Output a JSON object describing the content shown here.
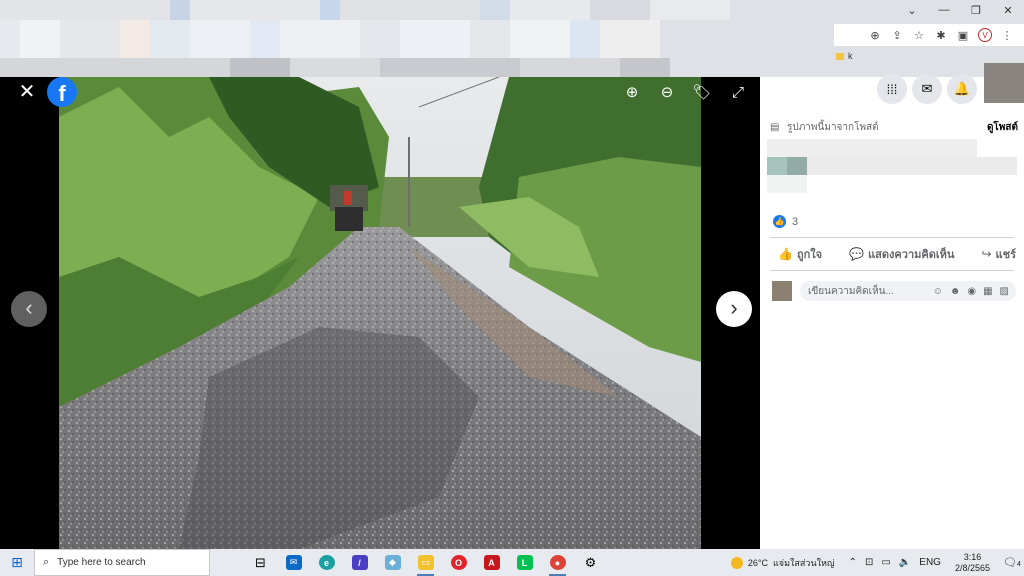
{
  "browser": {
    "window_controls": [
      "⌄",
      "—",
      "❐",
      "✕"
    ],
    "bookmark_tail": "k",
    "chrome_colors": [
      "#e9e9ec",
      "#dcdde3",
      "#cfd3db",
      "#c6d6ea",
      "#e2e4e8",
      "#d5d8de",
      "#ebeced",
      "#c9d3e2"
    ]
  },
  "viewer": {
    "close_label": "✕",
    "logo_letter": "f",
    "tools": {
      "zoom_in": "⊕",
      "zoom_out": "⊖",
      "tag": "🏷",
      "fullscreen": "⤢"
    },
    "prev_label": "‹",
    "next_label": "›"
  },
  "panel": {
    "from_post_text": "รูปภาพนี้มาจากโพสต์",
    "view_post_link": "ดูโพสต์",
    "reaction_count": "3",
    "like_label": "ถูกใจ",
    "comment_label": "แสดงความคิดเห็น",
    "share_label": "แชร์",
    "comment_placeholder": "เขียนความคิดเห็น...",
    "accent": "#1877f2"
  },
  "taskbar": {
    "search_placeholder": "Type here to search",
    "weather_temp": "26°C",
    "weather_text": "แจ่มใสส่วนใหญ่",
    "language": "ENG",
    "time": "3:16",
    "date": "2/8/2565",
    "notification_count": "4"
  }
}
